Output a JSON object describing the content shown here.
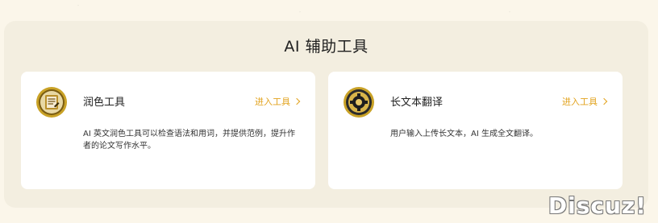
{
  "panel": {
    "title": "AI 辅助工具"
  },
  "tools": [
    {
      "name": "润色工具",
      "link_label": "进入工具",
      "icon": "scroll-emblem-icon",
      "description": "AI 英文润色工具可以检查语法和用词，并提供范例，提升作者的论文写作水平。"
    },
    {
      "name": "长文本翻译",
      "link_label": "进入工具",
      "icon": "translation-emblem-icon",
      "description": "用户输入上传长文本，AI 生成全文翻译。"
    }
  ],
  "branding": {
    "logo_text": "Discuz!"
  },
  "colors": {
    "accent": "#e2a21c",
    "panel_bg": "#f3eee0",
    "page_bg": "#fbf6ea",
    "card_bg": "#ffffff"
  }
}
